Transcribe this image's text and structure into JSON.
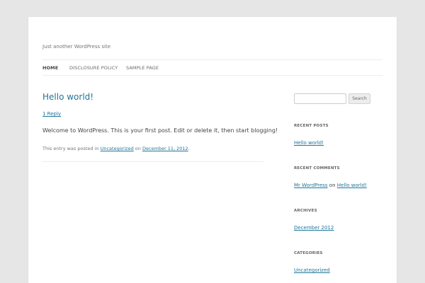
{
  "site": {
    "tagline": "Just another WordPress site"
  },
  "nav": {
    "items": [
      {
        "label": "HOME"
      },
      {
        "label": "DISCLOSURE POLICY"
      },
      {
        "label": "SAMPLE PAGE"
      }
    ]
  },
  "post": {
    "title": "Hello world!",
    "reply_link": "1 Reply",
    "content": "Welcome to WordPress. This is your first post. Edit or delete it, then start blogging!",
    "meta_prefix": "This entry was posted in",
    "category": "Uncategorized",
    "meta_on": "on",
    "date": "December 11, 2012",
    "meta_suffix": "."
  },
  "sidebar": {
    "search": {
      "placeholder": "",
      "button_label": "Search"
    },
    "recent_posts": {
      "title": "RECENT POSTS",
      "items": [
        "Hello world!"
      ]
    },
    "recent_comments": {
      "title": "RECENT COMMENTS",
      "author": "Mr WordPress",
      "on": "on",
      "post": "Hello world!"
    },
    "archives": {
      "title": "ARCHIVES",
      "items": [
        "December 2012"
      ]
    },
    "categories": {
      "title": "CATEGORIES",
      "items": [
        "Uncategorized"
      ]
    }
  },
  "colors": {
    "background": "#e6e6e6",
    "link": "#21759b",
    "text": "#444444"
  }
}
